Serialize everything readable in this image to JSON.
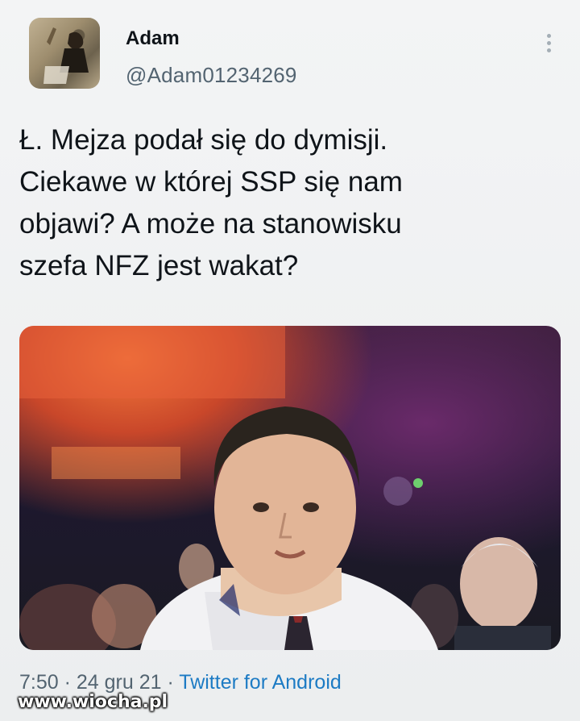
{
  "author": {
    "name": "Adam",
    "handle": "@Adam01234269"
  },
  "tweet": {
    "text": "Ł. Mejza podał się do dymisji.\nCiekawe w której SSP się nam\nobjawi? A może na stanowisku\nszefa NFZ jest wakat?"
  },
  "meta": {
    "time": "7:50",
    "separator1": " · ",
    "date": "24 gru 21",
    "separator2": " · ",
    "app": "Twitter for Android"
  },
  "watermark": "www.wiocha.pl",
  "icons": {
    "more": "more-vertical-icon"
  }
}
